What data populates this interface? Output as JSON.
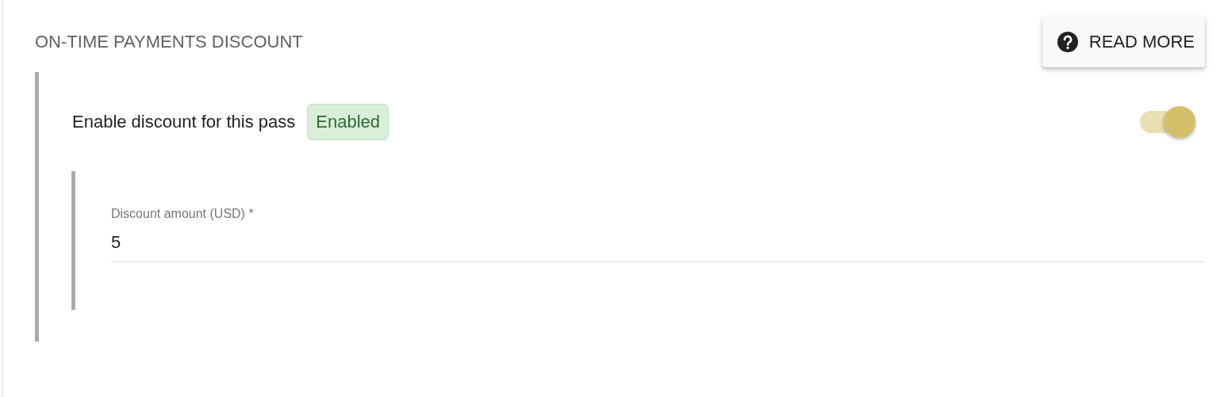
{
  "section": {
    "title": "ON-TIME PAYMENTS DISCOUNT",
    "read_more_button": {
      "label": "READ MORE"
    }
  },
  "enable_row": {
    "label": "Enable discount for this pass",
    "badge": "Enabled",
    "on": true
  },
  "amount_field": {
    "label": "Discount amount (USD) *",
    "value": "5"
  }
}
